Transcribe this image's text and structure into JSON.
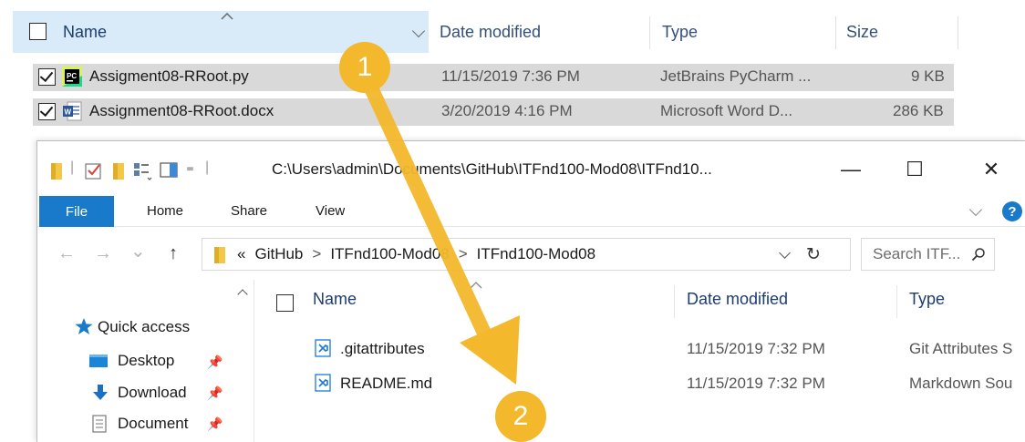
{
  "top_list": {
    "columns": {
      "name": "Name",
      "date": "Date modified",
      "type": "Type",
      "size": "Size"
    },
    "files": [
      {
        "name": "Assigment08-RRoot.py",
        "date": "11/15/2019 7:36 PM",
        "type": "JetBrains PyCharm ...",
        "size": "9 KB",
        "icon": "pycharm-file-icon",
        "checked": true
      },
      {
        "name": "Assignment08-RRoot.docx",
        "date": "3/20/2019 4:16 PM",
        "type": "Microsoft Word D...",
        "size": "286 KB",
        "icon": "word-file-icon",
        "checked": true
      }
    ]
  },
  "window": {
    "title_path": "C:\\Users\\admin\\Documents\\GitHub\\ITFnd100-Mod08\\ITFnd10...",
    "controls": {
      "minimize": "—",
      "maximize": "☐",
      "close": "✕"
    },
    "ribbon_tabs": [
      "File",
      "Home",
      "Share",
      "View"
    ],
    "help_label": "?",
    "nav": {
      "back": "←",
      "forward": "→",
      "recent": "⌄",
      "up": "↑",
      "breadcrumb_prefix": "«",
      "breadcrumb": [
        "GitHub",
        "ITFnd100-Mod08",
        "ITFnd100-Mod08"
      ],
      "refresh": "↻",
      "search_placeholder": "Search ITF...",
      "search_icon": "search-icon"
    },
    "nav_pane": [
      {
        "label": "Quick access",
        "icon": "star-icon"
      },
      {
        "label": "Desktop",
        "icon": "desktop-icon",
        "pinned": true
      },
      {
        "label": "Download",
        "icon": "download-icon",
        "pinned": true
      },
      {
        "label": "Document",
        "icon": "document-icon",
        "pinned": true
      }
    ],
    "columns": {
      "name": "Name",
      "date": "Date modified",
      "type": "Type"
    },
    "files": [
      {
        "name": ".gitattributes",
        "date": "11/15/2019 7:32 PM",
        "type": "Git Attributes S",
        "icon": "vscode-file-icon"
      },
      {
        "name": "README.md",
        "date": "11/15/2019 7:32 PM",
        "type": "Markdown Sou",
        "icon": "vscode-file-icon"
      }
    ]
  },
  "annotation": {
    "badges": [
      "1",
      "2"
    ],
    "arrow_color": "#f3b82c"
  },
  "colors": {
    "selection": "#d9d9d9",
    "header_highlight": "#d9ebf9",
    "accent": "#1979ca",
    "folder": "#f2c84b"
  }
}
